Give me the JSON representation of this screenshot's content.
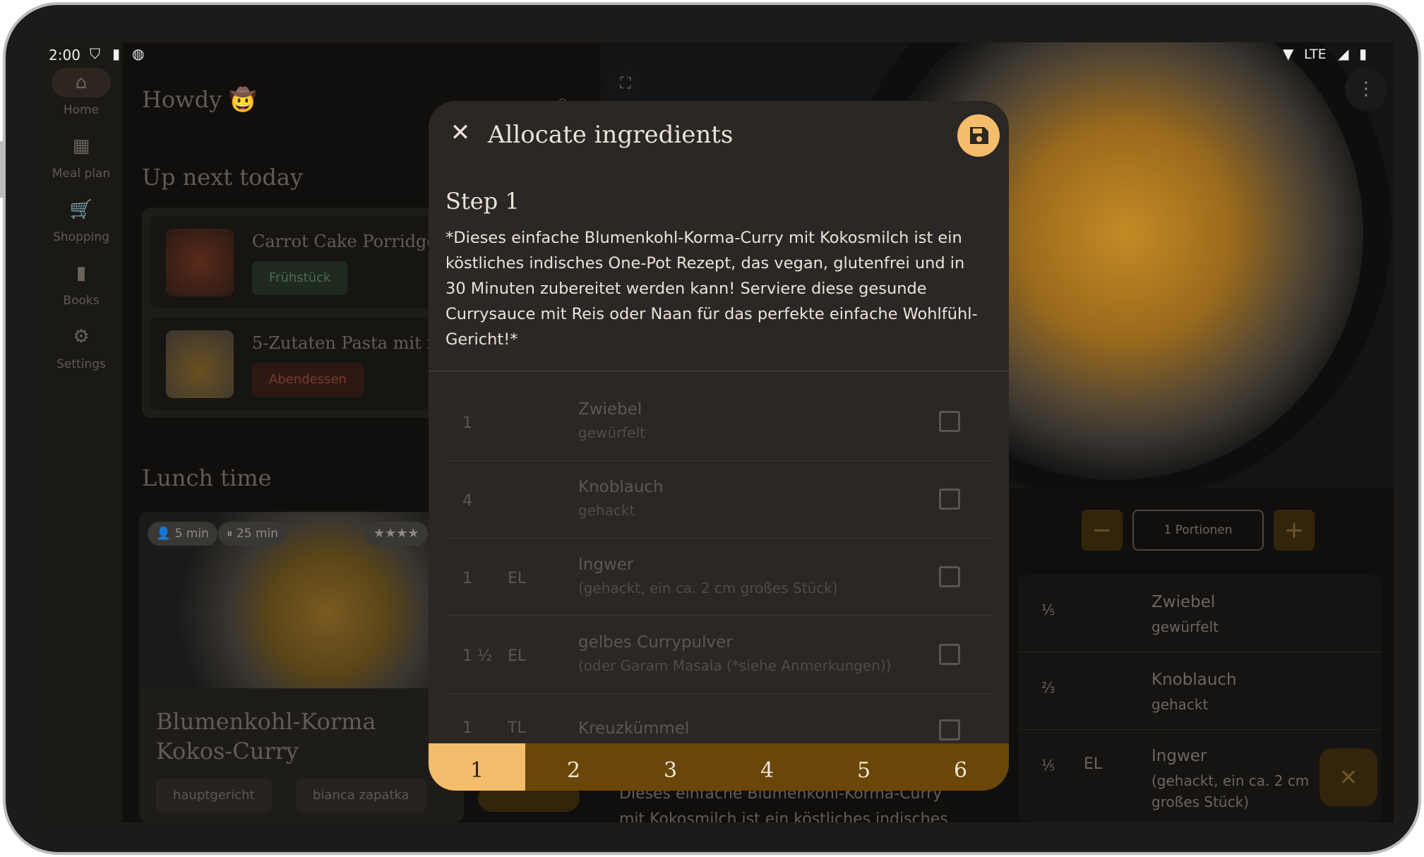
{
  "status_bar": {
    "time": "2:00",
    "network": "LTE"
  },
  "nav_rail": [
    {
      "label": "Home",
      "icon": "home-icon"
    },
    {
      "label": "Meal plan",
      "icon": "calendar-icon"
    },
    {
      "label": "Shopping",
      "icon": "cart-icon"
    },
    {
      "label": "Books",
      "icon": "book-icon"
    },
    {
      "label": "Settings",
      "icon": "gear-icon"
    }
  ],
  "home": {
    "greeting": "Howdy 🤠",
    "up_next_title": "Up next today",
    "up_next": [
      {
        "title": "Carrot Cake Porridge",
        "tag": "Frühstück"
      },
      {
        "title": "5-Zutaten Pasta mit r",
        "tag": "Abendessen"
      }
    ],
    "lunch_title": "Lunch time",
    "lunch_card": {
      "prep": "5 min",
      "cook": "25 min",
      "title_line1": "Blumenkohl-Korma",
      "title_line2": "Kokos-Curry",
      "tags": [
        "hauptgericht",
        "bianca zapatka"
      ]
    }
  },
  "dialog": {
    "title": "Allocate ingredients",
    "step_title": "Step 1",
    "step_text": "*Dieses einfache Blumenkohl-Korma-Curry mit Kokosmilch ist ein köstliches indisches One-Pot Rezept, das vegan, glutenfrei und in 30 Minuten zubereitet werden kann! Serviere diese gesunde Currysauce mit Reis oder Naan für das perfekte einfache Wohlfühl-Gericht!*",
    "ingredients": [
      {
        "amount": "1",
        "unit": "",
        "name": "Zwiebel",
        "note": "gewürfelt"
      },
      {
        "amount": "4",
        "unit": "",
        "name": "Knoblauch",
        "note": "gehackt"
      },
      {
        "amount": "1",
        "unit": "EL",
        "name": "Ingwer",
        "note": "(gehackt, ein ca. 2 cm großes Stück)"
      },
      {
        "amount": "1 ½",
        "unit": "EL",
        "name": "gelbes Currypulver",
        "note": "(oder Garam Masala (*siehe Anmerkungen))"
      },
      {
        "amount": "1",
        "unit": "TL",
        "name": "Kreuzkümmel",
        "note": ""
      }
    ],
    "steps": [
      "1",
      "2",
      "3",
      "4",
      "5",
      "6"
    ]
  },
  "recipe_panel": {
    "servings": "1 Portionen",
    "ingredients": [
      {
        "amount": "⅕",
        "unit": "",
        "name": "Zwiebel",
        "note": "gewürfelt"
      },
      {
        "amount": "⅔",
        "unit": "",
        "name": "Knoblauch",
        "note": "gehackt"
      },
      {
        "amount": "⅕",
        "unit": "EL",
        "name": "Ingwer",
        "note_line1": "(gehackt, ein ca. 2 cm",
        "note_line2": "großes Stück)"
      }
    ],
    "description_line1": "Dieses einfache Blumenkohl-Korma-Curry",
    "description_line2": "mit Kokosmilch ist ein köstliches indisches"
  },
  "colors": {
    "accent": "#f3bd6b",
    "dialog_bg": "#2b2724",
    "tab_bar": "#6a4708"
  }
}
